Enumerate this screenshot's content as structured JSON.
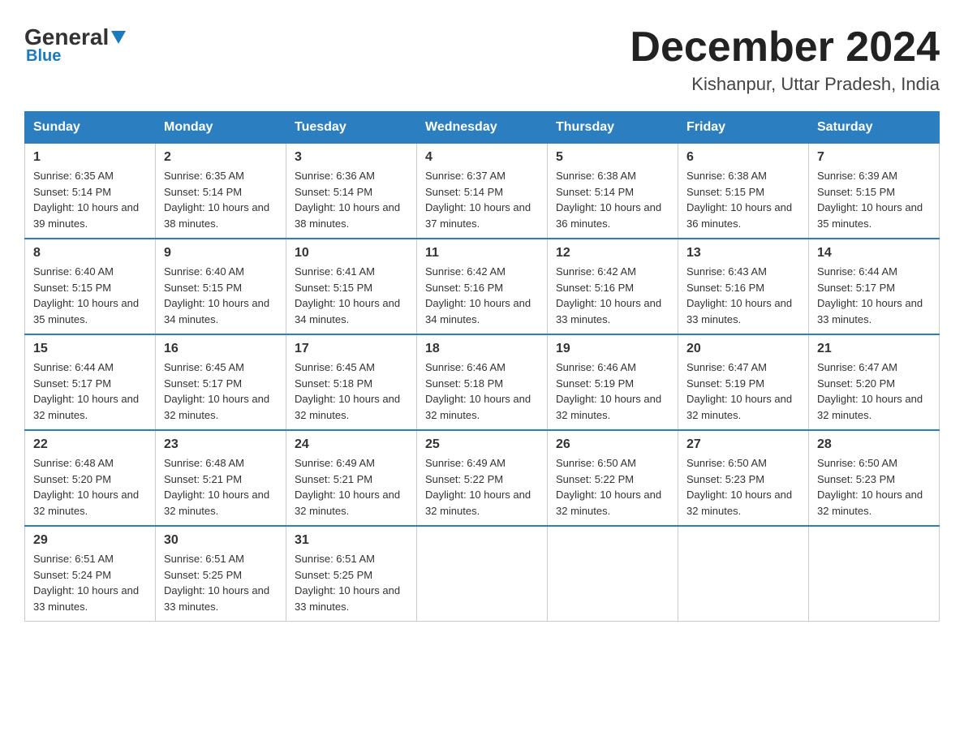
{
  "header": {
    "logo_text1": "General",
    "logo_text2": "Blue",
    "month_year": "December 2024",
    "location": "Kishanpur, Uttar Pradesh, India"
  },
  "days_of_week": [
    "Sunday",
    "Monday",
    "Tuesday",
    "Wednesday",
    "Thursday",
    "Friday",
    "Saturday"
  ],
  "weeks": [
    [
      {
        "day": "1",
        "sunrise": "6:35 AM",
        "sunset": "5:14 PM",
        "daylight": "10 hours and 39 minutes."
      },
      {
        "day": "2",
        "sunrise": "6:35 AM",
        "sunset": "5:14 PM",
        "daylight": "10 hours and 38 minutes."
      },
      {
        "day": "3",
        "sunrise": "6:36 AM",
        "sunset": "5:14 PM",
        "daylight": "10 hours and 38 minutes."
      },
      {
        "day": "4",
        "sunrise": "6:37 AM",
        "sunset": "5:14 PM",
        "daylight": "10 hours and 37 minutes."
      },
      {
        "day": "5",
        "sunrise": "6:38 AM",
        "sunset": "5:14 PM",
        "daylight": "10 hours and 36 minutes."
      },
      {
        "day": "6",
        "sunrise": "6:38 AM",
        "sunset": "5:15 PM",
        "daylight": "10 hours and 36 minutes."
      },
      {
        "day": "7",
        "sunrise": "6:39 AM",
        "sunset": "5:15 PM",
        "daylight": "10 hours and 35 minutes."
      }
    ],
    [
      {
        "day": "8",
        "sunrise": "6:40 AM",
        "sunset": "5:15 PM",
        "daylight": "10 hours and 35 minutes."
      },
      {
        "day": "9",
        "sunrise": "6:40 AM",
        "sunset": "5:15 PM",
        "daylight": "10 hours and 34 minutes."
      },
      {
        "day": "10",
        "sunrise": "6:41 AM",
        "sunset": "5:15 PM",
        "daylight": "10 hours and 34 minutes."
      },
      {
        "day": "11",
        "sunrise": "6:42 AM",
        "sunset": "5:16 PM",
        "daylight": "10 hours and 34 minutes."
      },
      {
        "day": "12",
        "sunrise": "6:42 AM",
        "sunset": "5:16 PM",
        "daylight": "10 hours and 33 minutes."
      },
      {
        "day": "13",
        "sunrise": "6:43 AM",
        "sunset": "5:16 PM",
        "daylight": "10 hours and 33 minutes."
      },
      {
        "day": "14",
        "sunrise": "6:44 AM",
        "sunset": "5:17 PM",
        "daylight": "10 hours and 33 minutes."
      }
    ],
    [
      {
        "day": "15",
        "sunrise": "6:44 AM",
        "sunset": "5:17 PM",
        "daylight": "10 hours and 32 minutes."
      },
      {
        "day": "16",
        "sunrise": "6:45 AM",
        "sunset": "5:17 PM",
        "daylight": "10 hours and 32 minutes."
      },
      {
        "day": "17",
        "sunrise": "6:45 AM",
        "sunset": "5:18 PM",
        "daylight": "10 hours and 32 minutes."
      },
      {
        "day": "18",
        "sunrise": "6:46 AM",
        "sunset": "5:18 PM",
        "daylight": "10 hours and 32 minutes."
      },
      {
        "day": "19",
        "sunrise": "6:46 AM",
        "sunset": "5:19 PM",
        "daylight": "10 hours and 32 minutes."
      },
      {
        "day": "20",
        "sunrise": "6:47 AM",
        "sunset": "5:19 PM",
        "daylight": "10 hours and 32 minutes."
      },
      {
        "day": "21",
        "sunrise": "6:47 AM",
        "sunset": "5:20 PM",
        "daylight": "10 hours and 32 minutes."
      }
    ],
    [
      {
        "day": "22",
        "sunrise": "6:48 AM",
        "sunset": "5:20 PM",
        "daylight": "10 hours and 32 minutes."
      },
      {
        "day": "23",
        "sunrise": "6:48 AM",
        "sunset": "5:21 PM",
        "daylight": "10 hours and 32 minutes."
      },
      {
        "day": "24",
        "sunrise": "6:49 AM",
        "sunset": "5:21 PM",
        "daylight": "10 hours and 32 minutes."
      },
      {
        "day": "25",
        "sunrise": "6:49 AM",
        "sunset": "5:22 PM",
        "daylight": "10 hours and 32 minutes."
      },
      {
        "day": "26",
        "sunrise": "6:50 AM",
        "sunset": "5:22 PM",
        "daylight": "10 hours and 32 minutes."
      },
      {
        "day": "27",
        "sunrise": "6:50 AM",
        "sunset": "5:23 PM",
        "daylight": "10 hours and 32 minutes."
      },
      {
        "day": "28",
        "sunrise": "6:50 AM",
        "sunset": "5:23 PM",
        "daylight": "10 hours and 32 minutes."
      }
    ],
    [
      {
        "day": "29",
        "sunrise": "6:51 AM",
        "sunset": "5:24 PM",
        "daylight": "10 hours and 33 minutes."
      },
      {
        "day": "30",
        "sunrise": "6:51 AM",
        "sunset": "5:25 PM",
        "daylight": "10 hours and 33 minutes."
      },
      {
        "day": "31",
        "sunrise": "6:51 AM",
        "sunset": "5:25 PM",
        "daylight": "10 hours and 33 minutes."
      },
      null,
      null,
      null,
      null
    ]
  ]
}
